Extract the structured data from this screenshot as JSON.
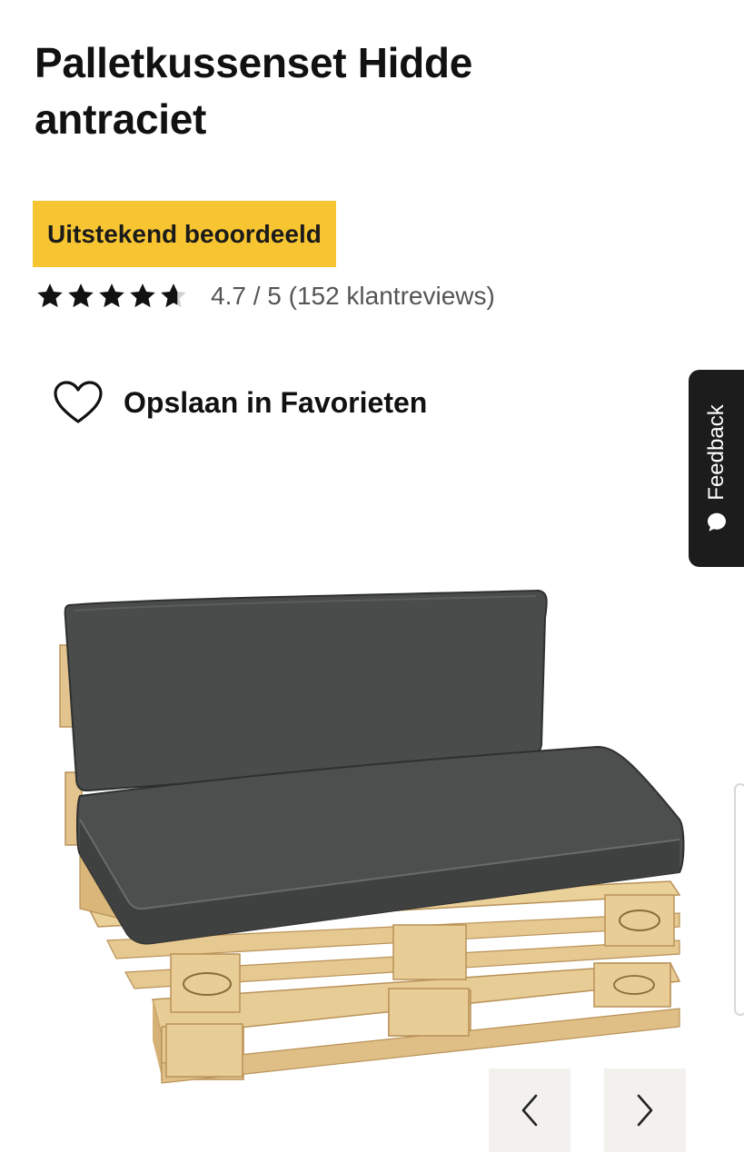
{
  "product": {
    "title": "Palletkussenset Hidde antraciet",
    "badge": "Uitstekend beoordeeld",
    "rating": {
      "value": 4.7,
      "max": 5,
      "text": "4.7 / 5 (152 klantreviews)"
    },
    "favorite_label": "Opslaan in Favorieten"
  },
  "feedback": {
    "label": "Feedback"
  },
  "colors": {
    "badge_bg": "#f7c531",
    "feedback_bg": "#1c1c1c",
    "nav_bg": "#f3f1ee"
  },
  "icons": {
    "favorite": "heart-outline-icon",
    "feedback": "chat-bubble-icon",
    "prev": "chevron-left-icon",
    "next": "chevron-right-icon"
  }
}
